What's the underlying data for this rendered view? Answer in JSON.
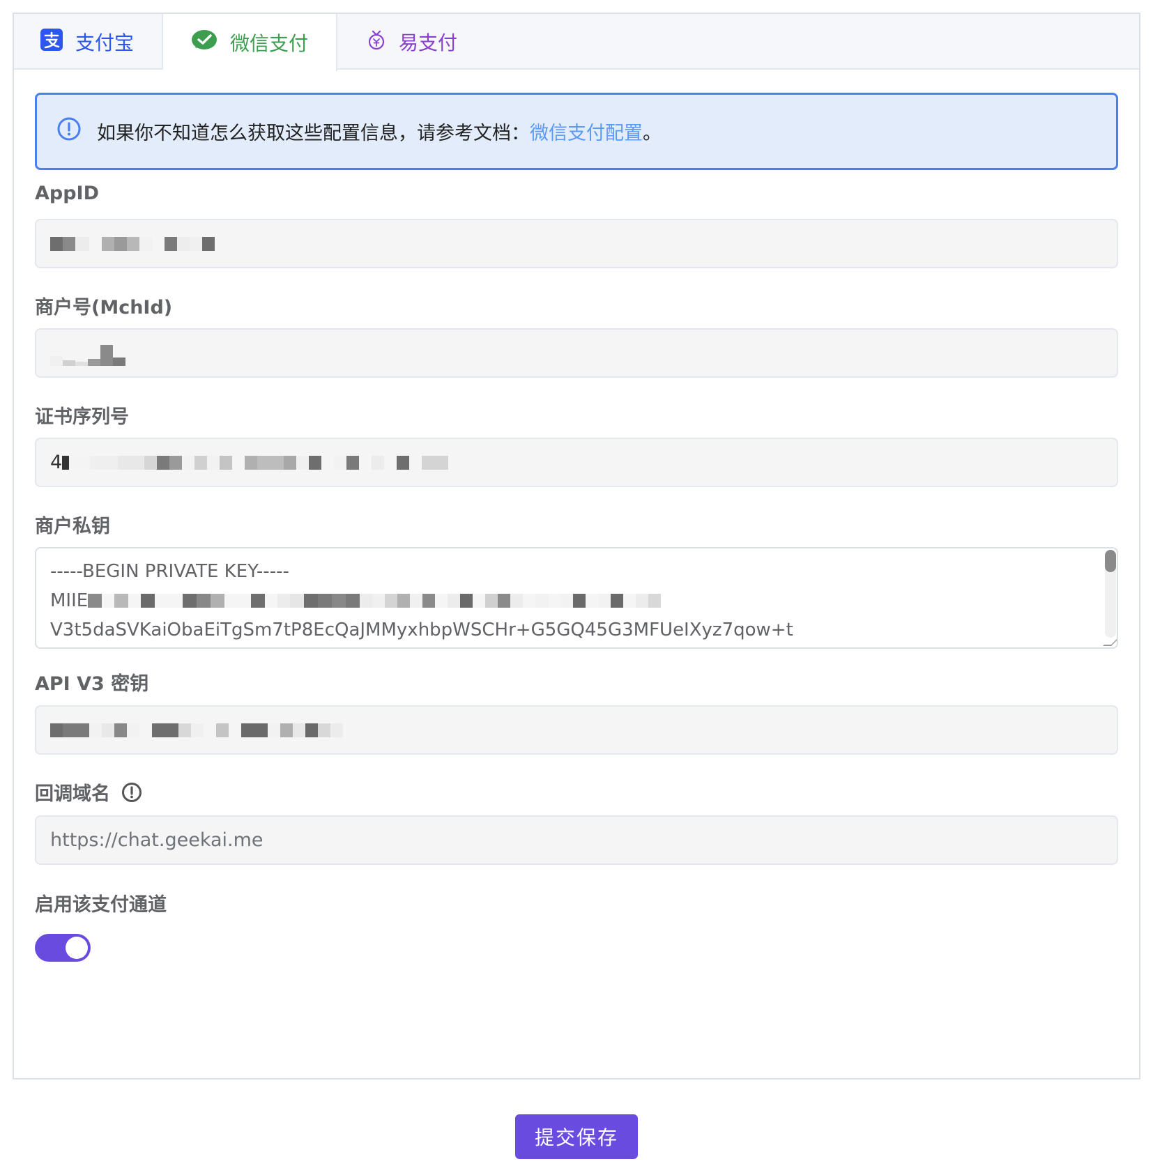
{
  "tabs": [
    {
      "label": "支付宝",
      "icon": "alipay-icon",
      "color": "#2b56f0",
      "active": false
    },
    {
      "label": "微信支付",
      "icon": "wechat-pay-icon",
      "color": "#3e9e50",
      "active": true
    },
    {
      "label": "易支付",
      "icon": "epay-icon",
      "color": "#8a3fd1",
      "active": false
    }
  ],
  "alert": {
    "icon": "info-circle-icon",
    "text": "如果你不知道怎么获取这些配置信息，请参考文档：",
    "link_text": "微信支付配置",
    "suffix": "。"
  },
  "fields": {
    "appid": {
      "label": "AppID",
      "value": "[masked]"
    },
    "mchid": {
      "label": "商户号(MchId)",
      "value": "[masked]"
    },
    "serial": {
      "label": "证书序列号",
      "value_prefix": "4",
      "value": "[masked]"
    },
    "private_key": {
      "label": "商户私钥",
      "line1": "-----BEGIN PRIVATE KEY-----",
      "line2_prefix": "MIIE",
      "line3": "V3t5daSVKaiObaEiTgSm7tP8EcQaJMMyxhbpWSCHr+G5GQ45G3MFUeIXyz7qow+t"
    },
    "api_v3_key": {
      "label": "API V3 密钥",
      "value": "[masked]"
    },
    "callback_domain": {
      "label": "回调域名",
      "icon": "warning-circle-icon",
      "value": "https://chat.geekai.me"
    },
    "enable": {
      "label": "启用该支付通道",
      "enabled": true
    }
  },
  "submit": {
    "label": "提交保存"
  },
  "colors": {
    "accent": "#6a4be0",
    "alert_border": "#4a7ff0",
    "alert_bg": "#e3ecfb",
    "link": "#5b9af2"
  }
}
